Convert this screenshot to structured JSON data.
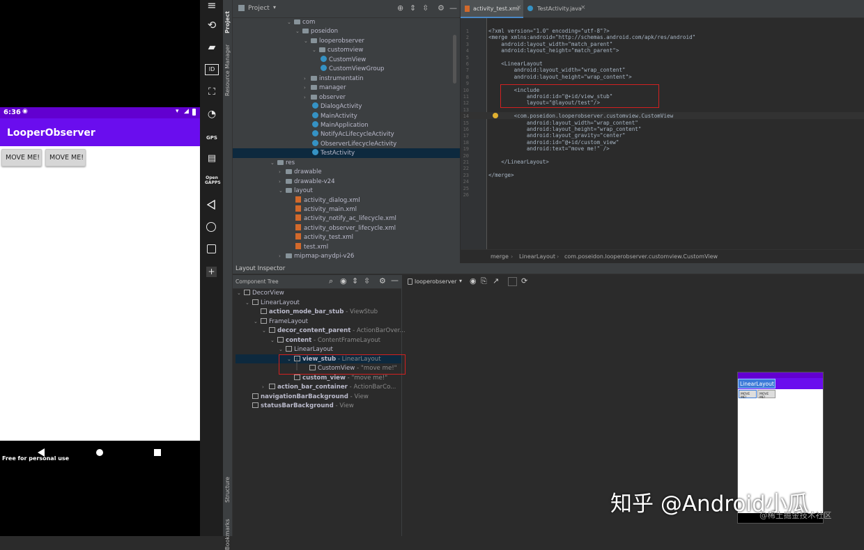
{
  "phone": {
    "time": "6:36",
    "app_title": "LooperObserver",
    "buttons": [
      "MOVE ME!",
      "MOVE ME!"
    ],
    "watermark": "Free for personal use",
    "colors": {
      "status": "#6200d0",
      "appbar": "#6a0dee"
    }
  },
  "emulator_toolbar": {
    "gps_label": "GPS",
    "open_gapps_label": "Open GAPPS"
  },
  "side_tabs": {
    "project": "Project",
    "resource_manager": "Resource Manager",
    "structure": "Structure",
    "bookmarks": "Bookmarks"
  },
  "project_panel": {
    "dropdown_label": "Project",
    "tree": [
      {
        "label": "com",
        "icon": "folder",
        "expanded": true
      },
      {
        "label": "poseidon",
        "icon": "folder",
        "expanded": true
      },
      {
        "label": "looperobserver",
        "icon": "folder",
        "expanded": true
      },
      {
        "label": "customview",
        "icon": "folder",
        "expanded": true
      },
      {
        "label": "CustomView",
        "icon": "class"
      },
      {
        "label": "CustomViewGroup",
        "icon": "class"
      },
      {
        "label": "instrumentatin",
        "icon": "folder",
        "expanded": false
      },
      {
        "label": "manager",
        "icon": "folder",
        "expanded": false
      },
      {
        "label": "observer",
        "icon": "folder",
        "expanded": false
      },
      {
        "label": "DialogActivity",
        "icon": "class"
      },
      {
        "label": "MainActivity",
        "icon": "class"
      },
      {
        "label": "MainApplication",
        "icon": "class"
      },
      {
        "label": "NotifyAcLifecycleActivity",
        "icon": "class"
      },
      {
        "label": "ObserverLifecycleActivity",
        "icon": "class"
      },
      {
        "label": "TestActivity",
        "icon": "class",
        "selected": true
      },
      {
        "label": "res",
        "icon": "folder",
        "expanded": true
      },
      {
        "label": "drawable",
        "icon": "folder",
        "expanded": false
      },
      {
        "label": "drawable-v24",
        "icon": "folder",
        "expanded": false
      },
      {
        "label": "layout",
        "icon": "folder",
        "expanded": true
      },
      {
        "label": "activity_dialog.xml",
        "icon": "xml"
      },
      {
        "label": "activity_main.xml",
        "icon": "xml"
      },
      {
        "label": "activity_notify_ac_lifecycle.xml",
        "icon": "xml"
      },
      {
        "label": "activity_observer_lifecycle.xml",
        "icon": "xml"
      },
      {
        "label": "activity_test.xml",
        "icon": "xml"
      },
      {
        "label": "test.xml",
        "icon": "xml"
      },
      {
        "label": "mipmap-anydpi-v26",
        "icon": "folder",
        "expanded": false
      }
    ]
  },
  "editor": {
    "tabs": [
      {
        "label": "activity_test.xml",
        "active": true
      },
      {
        "label": "TestActivity.java",
        "active": false
      }
    ],
    "line_numbers": [
      "1",
      "2",
      "3",
      "4",
      "5",
      "6",
      "7",
      "8",
      "9",
      "10",
      "11",
      "12",
      "13",
      "14",
      "15",
      "16",
      "17",
      "18",
      "19",
      "20",
      "21",
      "22",
      "23",
      "24",
      "25",
      "26"
    ],
    "lines": [
      "<?xml version=\"1.0\" encoding=\"utf-8\"?>",
      "<merge xmlns:android=\"http://schemas.android.com/apk/res/android\"",
      "    android:layout_width=\"match_parent\"",
      "    android:layout_height=\"match_parent\">",
      "",
      "    <LinearLayout",
      "        android:layout_width=\"wrap_content\"",
      "        android:layout_height=\"wrap_content\">",
      "",
      "        <include",
      "            android:id=\"@+id/view_stub\"",
      "            layout=\"@layout/test\"/>",
      "",
      "        <com.poseidon.looperobserver.customview.CustomView",
      "            android:layout_width=\"wrap_content\"",
      "            android:layout_height=\"wrap_content\"",
      "            android:layout_gravity=\"center\"",
      "            android:id=\"@+id/custom_view\"",
      "            android:text=\"move me!\" />",
      "",
      "    </LinearLayout>",
      "",
      "</merge>",
      "",
      "",
      ""
    ],
    "breadcrumb": [
      "merge",
      "LinearLayout",
      "com.poseidon.looperobserver.customview.CustomView"
    ]
  },
  "inspector": {
    "title": "Layout Inspector",
    "component_tree_label": "Component Tree",
    "process": "looperobserver",
    "tree": [
      {
        "name": "DecorView",
        "type": ""
      },
      {
        "name": "LinearLayout",
        "type": ""
      },
      {
        "name": "action_mode_bar_stub",
        "type": " - ViewStub",
        "bold": true
      },
      {
        "name": "FrameLayout",
        "type": ""
      },
      {
        "name": "decor_content_parent",
        "type": " - ActionBarOver...",
        "bold": true
      },
      {
        "name": "content",
        "type": " - ContentFrameLayout",
        "bold": true
      },
      {
        "name": "LinearLayout",
        "type": ""
      },
      {
        "name": "view_stub",
        "type": " - LinearLayout",
        "bold": true
      },
      {
        "name": "CustomView",
        "type": " - \"move me!\""
      },
      {
        "name": "custom_view",
        "type": " - \"move me!\"",
        "bold": true
      },
      {
        "name": "action_bar_container",
        "type": " - ActionBarCo...",
        "bold": true
      },
      {
        "name": "navigationBarBackground",
        "type": " - View",
        "bold": true
      },
      {
        "name": "statusBarBackground",
        "type": " - View",
        "bold": true
      }
    ],
    "preview": {
      "title": "LinearLayout",
      "buttons": [
        "MOVE ME!",
        "MOVE ME!"
      ]
    }
  },
  "overlay": {
    "watermark_main": "知乎 @Android小瓜",
    "watermark_sub": "@稀土掘金技术社区"
  }
}
